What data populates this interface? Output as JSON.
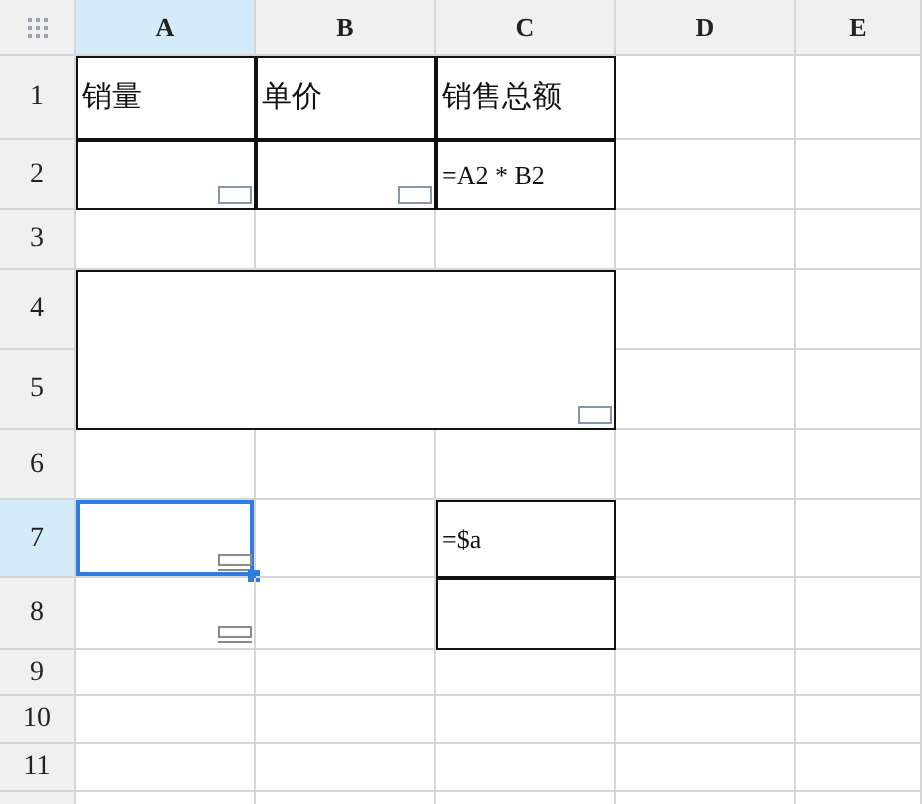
{
  "columns": [
    {
      "label": "A",
      "selected": true
    },
    {
      "label": "B",
      "selected": false
    },
    {
      "label": "C",
      "selected": false
    },
    {
      "label": "D",
      "selected": false
    },
    {
      "label": "E",
      "selected": false
    }
  ],
  "rows": [
    {
      "label": "1",
      "selected": false,
      "cells": [
        {
          "kind": "plain",
          "text": "销量",
          "outlined": true,
          "selected": false
        },
        {
          "kind": "plain",
          "text": "单价",
          "outlined": true,
          "selected": false
        },
        {
          "kind": "plain",
          "text": "销售总额",
          "outlined": true,
          "selected": false
        },
        {
          "kind": "plain",
          "outlined": false,
          "selected": false
        },
        {
          "kind": "plain",
          "outlined": false,
          "selected": false
        }
      ]
    },
    {
      "label": "2",
      "selected": false,
      "cells": [
        {
          "kind": "note",
          "outlined": true,
          "selected": false
        },
        {
          "kind": "note",
          "outlined": true,
          "selected": false
        },
        {
          "kind": "plain",
          "text": "=A2 * B2",
          "outlined": true,
          "selected": false
        },
        {
          "kind": "plain",
          "outlined": false,
          "selected": false
        },
        {
          "kind": "plain",
          "outlined": false,
          "selected": false
        }
      ]
    },
    {
      "label": "3",
      "selected": false,
      "cells": [
        {
          "kind": "plain",
          "outlined": false,
          "selected": false
        },
        {
          "kind": "plain",
          "outlined": false,
          "selected": false
        },
        {
          "kind": "plain",
          "outlined": false,
          "selected": false
        },
        {
          "kind": "plain",
          "outlined": false,
          "selected": false
        },
        {
          "kind": "plain",
          "outlined": false,
          "selected": false
        }
      ]
    },
    {
      "label": "4",
      "selected": false,
      "cells": [
        {
          "kind": "note",
          "outlined": true,
          "merged": true,
          "selected": false
        },
        {
          "kind": "plain",
          "outlined": false,
          "selected": false
        },
        {
          "kind": "plain",
          "outlined": false,
          "selected": false
        }
      ]
    },
    {
      "label": "5",
      "selected": false,
      "cells": [
        {
          "kind": "plain",
          "outlined": false,
          "selected": false
        },
        {
          "kind": "plain",
          "outlined": false,
          "selected": false
        }
      ]
    },
    {
      "label": "6",
      "selected": false,
      "cells": [
        {
          "kind": "plain",
          "outlined": false,
          "selected": false
        },
        {
          "kind": "plain",
          "outlined": false,
          "selected": false
        },
        {
          "kind": "plain",
          "outlined": false,
          "selected": false
        },
        {
          "kind": "plain",
          "outlined": false,
          "selected": false
        },
        {
          "kind": "plain",
          "outlined": false,
          "selected": false
        }
      ]
    },
    {
      "label": "7",
      "selected": true,
      "cells": [
        {
          "kind": "stacked",
          "outlined": false,
          "selected": true
        },
        {
          "kind": "plain",
          "outlined": false,
          "selected": false
        },
        {
          "kind": "plain",
          "text": "=$a",
          "outlined": true,
          "selected": false
        },
        {
          "kind": "plain",
          "outlined": false,
          "selected": false
        },
        {
          "kind": "plain",
          "outlined": false,
          "selected": false
        }
      ]
    },
    {
      "label": "8",
      "selected": false,
      "cells": [
        {
          "kind": "stacked",
          "outlined": false,
          "selected": false
        },
        {
          "kind": "plain",
          "outlined": false,
          "selected": false
        },
        {
          "kind": "plain",
          "outlined": true,
          "selected": false
        },
        {
          "kind": "plain",
          "outlined": false,
          "selected": false
        },
        {
          "kind": "plain",
          "outlined": false,
          "selected": false
        }
      ]
    },
    {
      "label": "9",
      "selected": false,
      "cells": [
        {
          "kind": "plain",
          "outlined": false,
          "selected": false
        },
        {
          "kind": "plain",
          "outlined": false,
          "selected": false
        },
        {
          "kind": "plain",
          "outlined": false,
          "selected": false
        },
        {
          "kind": "plain",
          "outlined": false,
          "selected": false
        },
        {
          "kind": "plain",
          "outlined": false,
          "selected": false
        }
      ]
    },
    {
      "label": "10",
      "selected": false,
      "cells": [
        {
          "kind": "plain",
          "outlined": false,
          "selected": false
        },
        {
          "kind": "plain",
          "outlined": false,
          "selected": false
        },
        {
          "kind": "plain",
          "outlined": false,
          "selected": false
        },
        {
          "kind": "plain",
          "outlined": false,
          "selected": false
        },
        {
          "kind": "plain",
          "outlined": false,
          "selected": false
        }
      ]
    },
    {
      "label": "11",
      "selected": false,
      "cells": [
        {
          "kind": "plain",
          "outlined": false,
          "selected": false
        },
        {
          "kind": "plain",
          "outlined": false,
          "selected": false
        },
        {
          "kind": "plain",
          "outlined": false,
          "selected": false
        },
        {
          "kind": "plain",
          "outlined": false,
          "selected": false
        },
        {
          "kind": "plain",
          "outlined": false,
          "selected": false
        }
      ]
    }
  ]
}
